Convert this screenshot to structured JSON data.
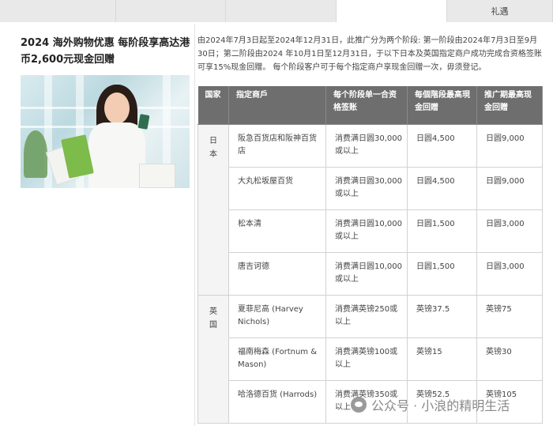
{
  "tabs": [
    "",
    "",
    "",
    "",
    "礼遇"
  ],
  "promo": {
    "title": "2024 海外购物优惠 每阶段享高达港币2,600元现金回赠",
    "description": "由2024年7月3日起至2024年12月31日，此推广分为两个阶段: 第一阶段由2024年7月3日至9月30日；第二阶段由2024 年10月1日至12月31日，于以下日本及英国指定商户成功完成合资格签账可享15%现金回赠。 每个阶段客户可于每个指定商户享现金回赠一次，毋须登记。"
  },
  "table": {
    "headers": [
      "国家",
      "指定商戶",
      "每个阶段单一合资格签账",
      "每個階段最高現金回贈",
      "推广期最高现金回赠"
    ],
    "groups": [
      {
        "country": "日本",
        "rows": [
          {
            "merchant": "阪急百货店和阪神百货店",
            "spend": "消费满日圆30,000或以上",
            "stage_max": "日圆4,500",
            "promo_max": "日圆9,000"
          },
          {
            "merchant": "大丸松坂屋百货",
            "spend": "消费满日圆30,000或以上",
            "stage_max": "日圆4,500",
            "promo_max": "日圆9,000"
          },
          {
            "merchant": "松本清",
            "spend": "消费满日圆10,000或以上",
            "stage_max": "日圆1,500",
            "promo_max": "日圆3,000"
          },
          {
            "merchant": "唐吉诃德",
            "spend": "消费满日圆10,000或以上",
            "stage_max": "日圆1,500",
            "promo_max": "日圆3,000"
          }
        ]
      },
      {
        "country": "英国",
        "rows": [
          {
            "merchant": "夏菲尼高 (Harvey Nichols)",
            "spend": "消费满英镑250或以上",
            "stage_max": "英镑37.5",
            "promo_max": "英镑75"
          },
          {
            "merchant": "福南梅森 (Fortnum & Mason)",
            "spend": "消费满英镑100或以上",
            "stage_max": "英镑15",
            "promo_max": "英镑30"
          },
          {
            "merchant": "哈洛德百货 (Harrods)",
            "spend": "消费满英镑350或以上",
            "stage_max": "英镑52.5",
            "promo_max": "英镑105"
          }
        ]
      }
    ]
  },
  "watermark": "公众号 · 小浪的精明生活"
}
